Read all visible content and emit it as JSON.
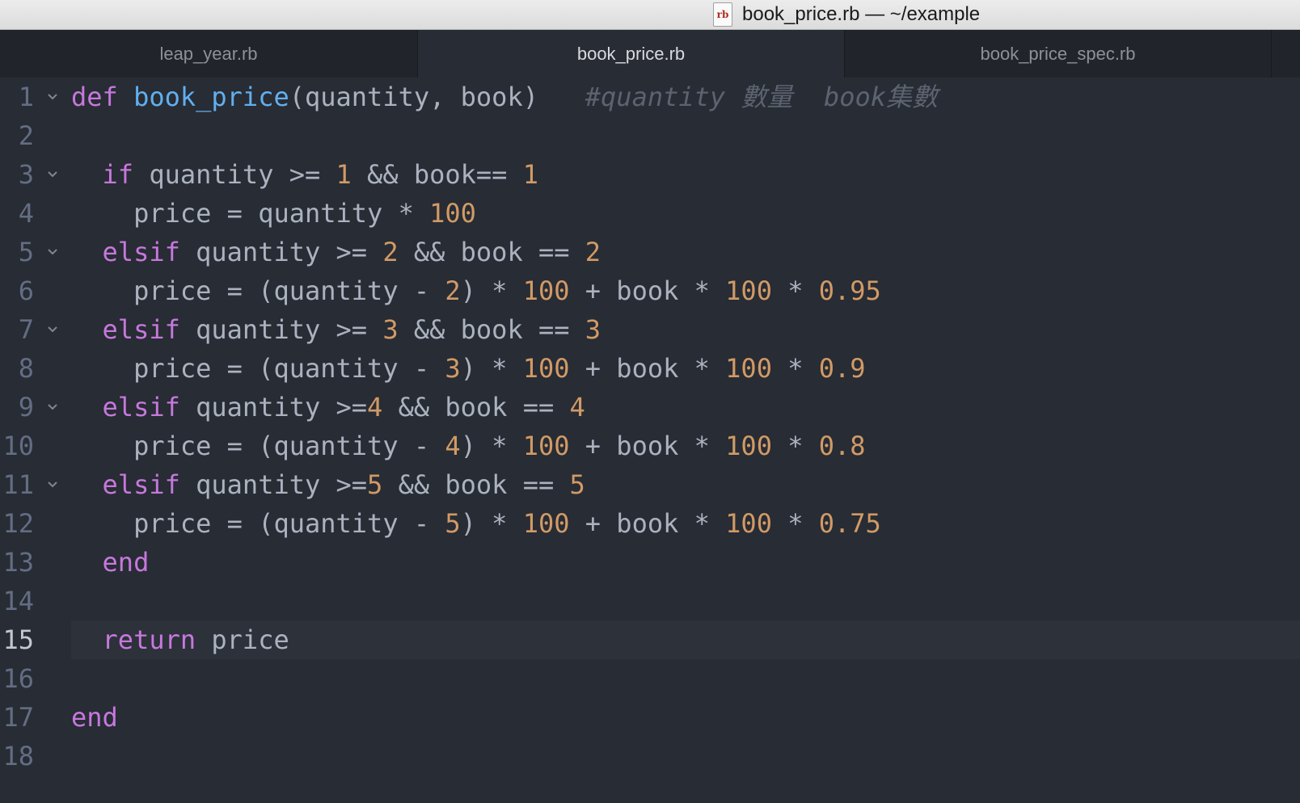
{
  "window": {
    "title": "book_price.rb — ~/example",
    "file_icon_label": "rb"
  },
  "tabs": [
    {
      "label": "leap_year.rb",
      "active": false
    },
    {
      "label": "book_price.rb",
      "active": true
    },
    {
      "label": "book_price_spec.rb",
      "active": false
    }
  ],
  "editor": {
    "current_line": 15,
    "lines": [
      {
        "number": "1",
        "fold": true,
        "tokens": [
          {
            "t": "def",
            "c": "kw"
          },
          {
            "t": " "
          },
          {
            "t": "book_price",
            "c": "fn"
          },
          {
            "t": "(quantity, book)"
          },
          {
            "t": "   "
          },
          {
            "t": "#quantity 數量  book集數",
            "c": "cm"
          }
        ]
      },
      {
        "number": "2",
        "fold": false,
        "tokens": []
      },
      {
        "number": "3",
        "fold": true,
        "tokens": [
          {
            "t": "  "
          },
          {
            "t": "if",
            "c": "kw"
          },
          {
            "t": " quantity >= "
          },
          {
            "t": "1",
            "c": "num"
          },
          {
            "t": " && book== "
          },
          {
            "t": "1",
            "c": "num"
          }
        ]
      },
      {
        "number": "4",
        "fold": false,
        "tokens": [
          {
            "t": "    price = quantity * "
          },
          {
            "t": "100",
            "c": "num"
          }
        ]
      },
      {
        "number": "5",
        "fold": true,
        "tokens": [
          {
            "t": "  "
          },
          {
            "t": "elsif",
            "c": "kw"
          },
          {
            "t": " quantity >= "
          },
          {
            "t": "2",
            "c": "num"
          },
          {
            "t": " && book == "
          },
          {
            "t": "2",
            "c": "num"
          }
        ]
      },
      {
        "number": "6",
        "fold": false,
        "tokens": [
          {
            "t": "    price = (quantity - "
          },
          {
            "t": "2",
            "c": "num"
          },
          {
            "t": ") * "
          },
          {
            "t": "100",
            "c": "num"
          },
          {
            "t": " + book * "
          },
          {
            "t": "100",
            "c": "num"
          },
          {
            "t": " * "
          },
          {
            "t": "0.95",
            "c": "num"
          }
        ]
      },
      {
        "number": "7",
        "fold": true,
        "tokens": [
          {
            "t": "  "
          },
          {
            "t": "elsif",
            "c": "kw"
          },
          {
            "t": " quantity >= "
          },
          {
            "t": "3",
            "c": "num"
          },
          {
            "t": " && book == "
          },
          {
            "t": "3",
            "c": "num"
          }
        ]
      },
      {
        "number": "8",
        "fold": false,
        "tokens": [
          {
            "t": "    price = (quantity - "
          },
          {
            "t": "3",
            "c": "num"
          },
          {
            "t": ") * "
          },
          {
            "t": "100",
            "c": "num"
          },
          {
            "t": " + book * "
          },
          {
            "t": "100",
            "c": "num"
          },
          {
            "t": " * "
          },
          {
            "t": "0.9",
            "c": "num"
          }
        ]
      },
      {
        "number": "9",
        "fold": true,
        "tokens": [
          {
            "t": "  "
          },
          {
            "t": "elsif",
            "c": "kw"
          },
          {
            "t": " quantity >="
          },
          {
            "t": "4",
            "c": "num"
          },
          {
            "t": " && book == "
          },
          {
            "t": "4",
            "c": "num"
          }
        ]
      },
      {
        "number": "10",
        "fold": false,
        "tokens": [
          {
            "t": "    price = (quantity - "
          },
          {
            "t": "4",
            "c": "num"
          },
          {
            "t": ") * "
          },
          {
            "t": "100",
            "c": "num"
          },
          {
            "t": " + book * "
          },
          {
            "t": "100",
            "c": "num"
          },
          {
            "t": " * "
          },
          {
            "t": "0.8",
            "c": "num"
          }
        ]
      },
      {
        "number": "11",
        "fold": true,
        "tokens": [
          {
            "t": "  "
          },
          {
            "t": "elsif",
            "c": "kw"
          },
          {
            "t": " quantity >="
          },
          {
            "t": "5",
            "c": "num"
          },
          {
            "t": " && book == "
          },
          {
            "t": "5",
            "c": "num"
          }
        ]
      },
      {
        "number": "12",
        "fold": false,
        "tokens": [
          {
            "t": "    price = (quantity - "
          },
          {
            "t": "5",
            "c": "num"
          },
          {
            "t": ") * "
          },
          {
            "t": "100",
            "c": "num"
          },
          {
            "t": " + book * "
          },
          {
            "t": "100",
            "c": "num"
          },
          {
            "t": " * "
          },
          {
            "t": "0.75",
            "c": "num"
          }
        ]
      },
      {
        "number": "13",
        "fold": false,
        "tokens": [
          {
            "t": "  "
          },
          {
            "t": "end",
            "c": "kw"
          }
        ]
      },
      {
        "number": "14",
        "fold": false,
        "tokens": []
      },
      {
        "number": "15",
        "fold": false,
        "tokens": [
          {
            "t": "  "
          },
          {
            "t": "return",
            "c": "kw"
          },
          {
            "t": " price"
          }
        ]
      },
      {
        "number": "16",
        "fold": false,
        "tokens": []
      },
      {
        "number": "17",
        "fold": false,
        "tokens": [
          {
            "t": "end",
            "c": "kw"
          }
        ]
      },
      {
        "number": "18",
        "fold": false,
        "tokens": []
      }
    ]
  },
  "colors": {
    "background": "#282c34",
    "keyword": "#c678dd",
    "function": "#61afef",
    "number": "#d19a66",
    "comment": "#5c6370",
    "text": "#abb2bf",
    "line_number": "#636d83"
  },
  "icons": {
    "file_icon": "ruby-file-icon",
    "fold_icon": "chevron-down-icon"
  }
}
